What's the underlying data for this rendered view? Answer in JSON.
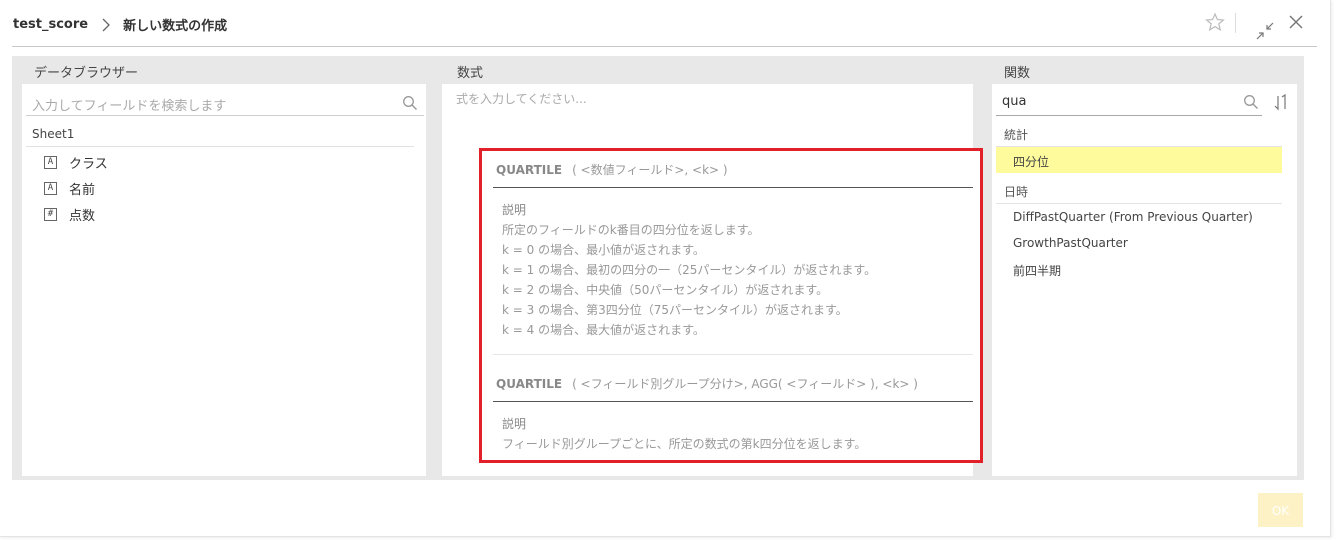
{
  "header": {
    "breadcrumb_root": "test_score",
    "title": "新しい数式の作成"
  },
  "data_browser": {
    "title": "データブラウザー",
    "search_placeholder": "入力してフィールドを検索します",
    "sheet": "Sheet1",
    "fields": [
      {
        "type": "A",
        "label": "クラス"
      },
      {
        "type": "A",
        "label": "名前"
      },
      {
        "type": "#",
        "label": "点数"
      }
    ]
  },
  "formula": {
    "title": "数式",
    "placeholder": "式を入力してください..."
  },
  "tooltip": {
    "sig1_name": "QUARTILE",
    "sig1_args": "( <数値フィールド>, <k> )",
    "desc_label": "説明",
    "sig1_desc": [
      "所定のフィールドのk番目の四分位を返します。",
      "k = 0 の場合、最小値が返されます。",
      "k = 1 の場合、最初の四分の一（25パーセンタイル）が返されます。",
      "k = 2 の場合、中央値（50パーセンタイル）が返されます。",
      "k = 3 の場合、第3四分位（75パーセンタイル）が返されます。",
      "k = 4 の場合、最大値が返されます。"
    ],
    "sig2_name": "QUARTILE",
    "sig2_args": "( <フィールド別グループ分け>, AGG( <フィールド> ), <k> )",
    "sig2_desc": "フィールド別グループごとに、所定の数式の第k四分位を返します。"
  },
  "functions": {
    "title": "関数",
    "search_value": "qua",
    "categories": [
      {
        "name": "統計",
        "items": [
          "四分位"
        ]
      },
      {
        "name": "日時",
        "items": [
          "DiffPastQuarter (From Previous Quarter)",
          "GrowthPastQuarter",
          "前四半期"
        ]
      }
    ]
  },
  "footer": {
    "ok_label": "OK"
  },
  "colors": {
    "highlight": "#fdfb9c",
    "tooltip_border": "#e2202a",
    "ok_disabled": "#fdf2c5"
  }
}
